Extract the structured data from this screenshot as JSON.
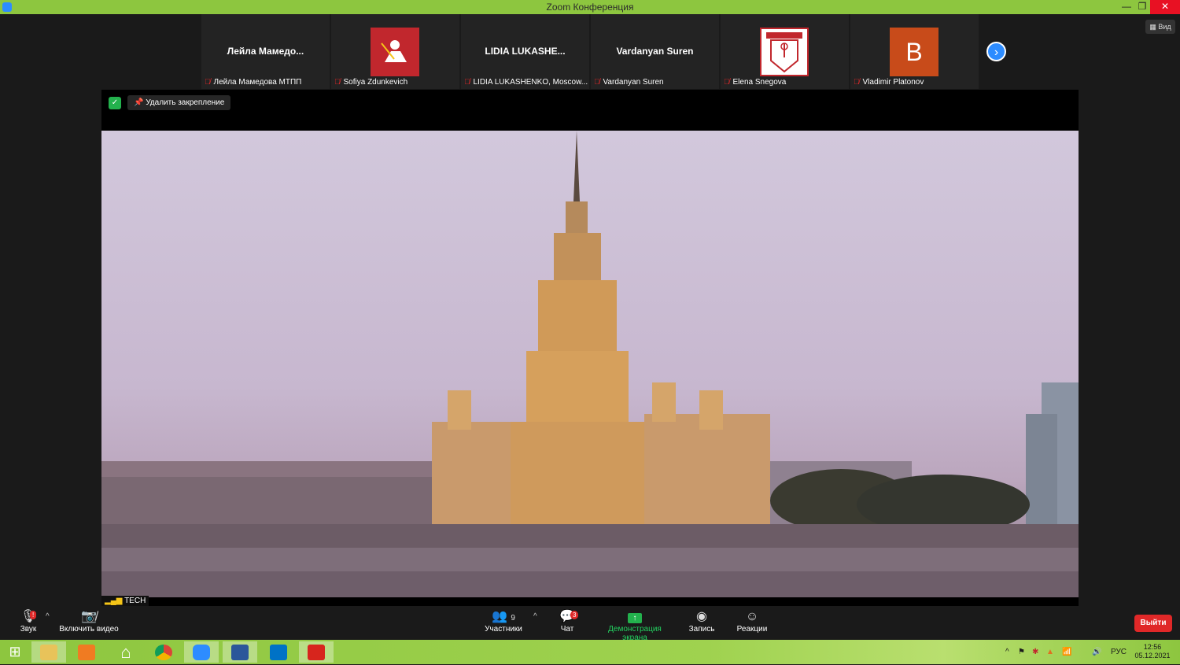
{
  "window": {
    "title": "Zoom Конференция"
  },
  "gallery": {
    "tiles": [
      {
        "display": "Лейла  Мамедо...",
        "label": "Лейла Мамедова МТПП",
        "kind": "name"
      },
      {
        "display": "",
        "label": "Sofiya Zdunkevich",
        "kind": "red-crest"
      },
      {
        "display": "LIDIA  LUKASHE...",
        "label": "LIDIA LUKASHENKO, Moscow...",
        "kind": "name"
      },
      {
        "display": "Vardanyan Suren",
        "label": "Vardanyan Suren",
        "kind": "name"
      },
      {
        "display": "",
        "label": "Elena Snegova",
        "kind": "white-crest"
      },
      {
        "display": "B",
        "label": "Vladimir Platonov",
        "kind": "avatar"
      }
    ],
    "next_icon": "chevron-right-icon"
  },
  "view_button": {
    "label": "Вид"
  },
  "stage": {
    "unpin_label": "Удалить закрепление",
    "source_label": "TECH"
  },
  "toolbar": {
    "audio": {
      "label": "Звук",
      "badge": "!"
    },
    "video": {
      "label": "Включить видео"
    },
    "participants": {
      "label": "Участники",
      "count": "9"
    },
    "chat": {
      "label": "Чат",
      "badge": "3"
    },
    "share": {
      "label": "Демонстрация экрана"
    },
    "record": {
      "label": "Запись"
    },
    "reactions": {
      "label": "Реакции"
    },
    "exit": {
      "label": "Выйти"
    }
  },
  "taskbar": {
    "language": "РУС",
    "time": "12:56",
    "date": "05.12.2021"
  },
  "colors": {
    "titlebar": "#8dc63f",
    "accent": "#2d8cff",
    "danger": "#e02828",
    "share_green": "#23d160"
  }
}
